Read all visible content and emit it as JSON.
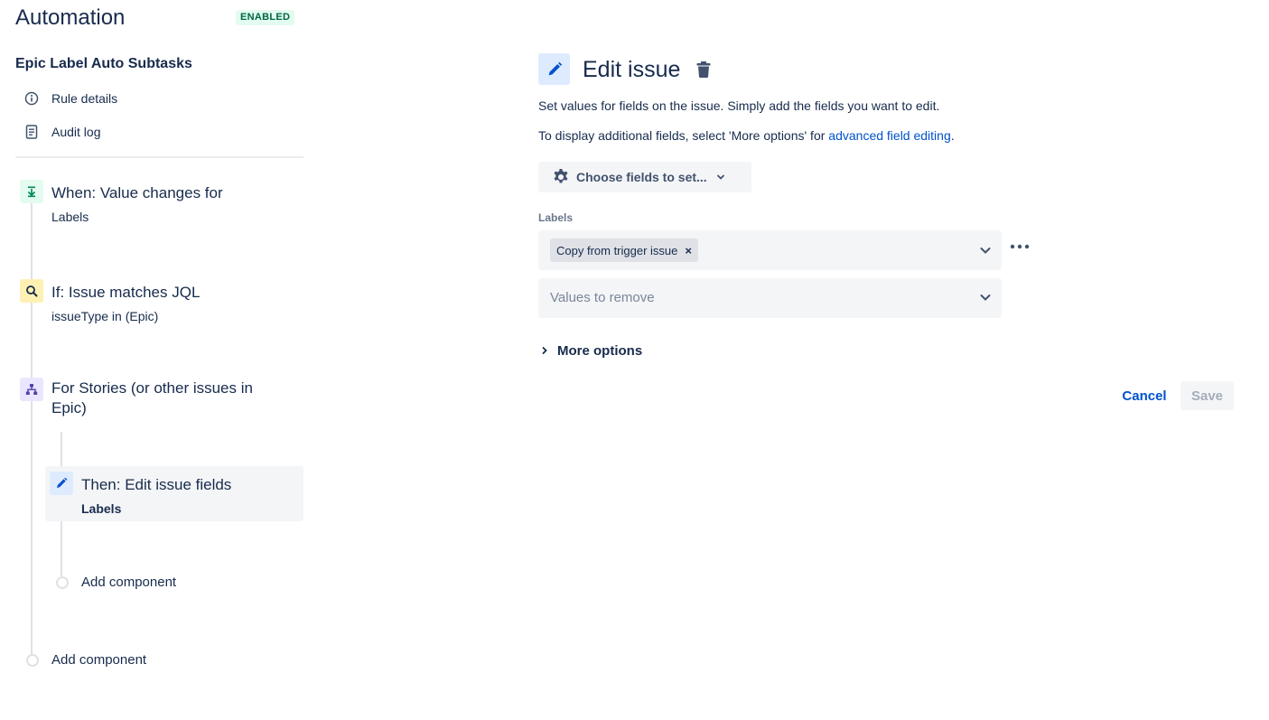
{
  "header": {
    "title": "Automation",
    "status": "ENABLED"
  },
  "sidebar": {
    "rule_name": "Epic Label Auto Subtasks",
    "links": [
      {
        "label": "Rule details",
        "icon": "info-icon"
      },
      {
        "label": "Audit log",
        "icon": "document-icon"
      }
    ],
    "components": [
      {
        "title": "When: Value changes for",
        "subtitle": "Labels",
        "icon": "trigger-icon"
      },
      {
        "title": "If: Issue matches JQL",
        "subtitle": "issueType in (Epic)",
        "icon": "search-icon"
      },
      {
        "title_line1": "For Stories (or other issues in",
        "title_line2": "Epic)",
        "icon": "branch-icon"
      },
      {
        "title": "Then: Edit issue fields",
        "subtitle": "Labels",
        "icon": "pencil-icon"
      }
    ],
    "add_component_inner": "Add component",
    "add_component_outer": "Add component"
  },
  "panel": {
    "title": "Edit issue",
    "description": "Set values for fields on the issue. Simply add the fields you want to edit.",
    "advanced_prefix": "To display additional fields, select 'More options' for ",
    "advanced_link": "advanced field editing",
    "advanced_suffix": ".",
    "choose_fields_label": "Choose fields to set...",
    "labels_field_label": "Labels",
    "labels_chip": "Copy from trigger issue",
    "remove_placeholder": "Values to remove",
    "more_options_label": "More options",
    "cancel_label": "Cancel",
    "save_label": "Save"
  },
  "colors": {
    "primary_text": "#172b4d",
    "link": "#0052cc",
    "enabled_bg": "#e3fcef",
    "enabled_text": "#006644",
    "trigger_icon_bg": "#e3fcef",
    "condition_icon_bg": "#fff0b3",
    "branch_icon_bg": "#eae6ff",
    "action_icon_bg": "#deebff"
  }
}
